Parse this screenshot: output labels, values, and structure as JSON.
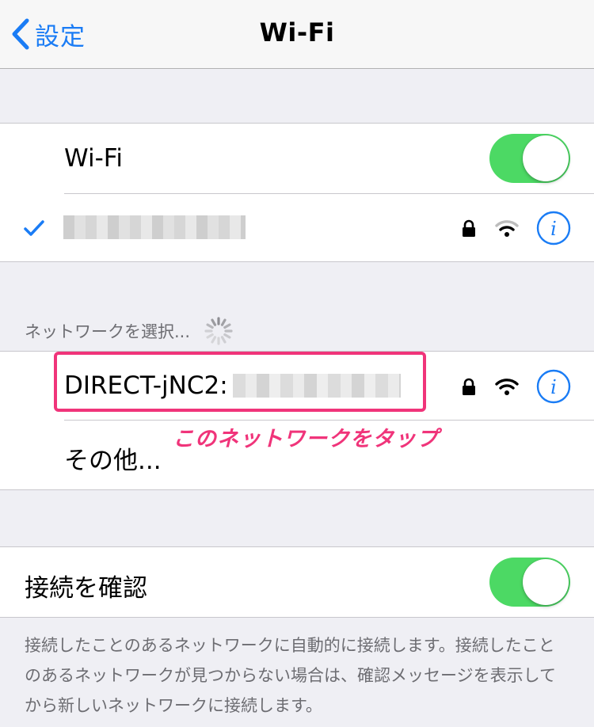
{
  "nav": {
    "back_label": "設定",
    "title": "Wi-Fi"
  },
  "wifi_group": {
    "wifi_label": "Wi-Fi",
    "wifi_toggle_on": true
  },
  "networks_section": {
    "header": "ネットワークを選択...",
    "network_name_visible": "DIRECT-jNC2:",
    "other_label": "その他..."
  },
  "annotation": {
    "text": "このネットワークをタップ"
  },
  "ask_group": {
    "label": "接続を確認",
    "toggle_on": true,
    "footer": "接続したことのあるネットワークに自動的に接続します。接続したことのあるネットワークが見つからない場合は、確認メッセージを表示してから新しいネットワークに接続します。"
  },
  "colors": {
    "accent": "#1a7cf5",
    "toggle_on": "#4cd964",
    "annotation": "#f0347a",
    "background": "#efeff4"
  }
}
